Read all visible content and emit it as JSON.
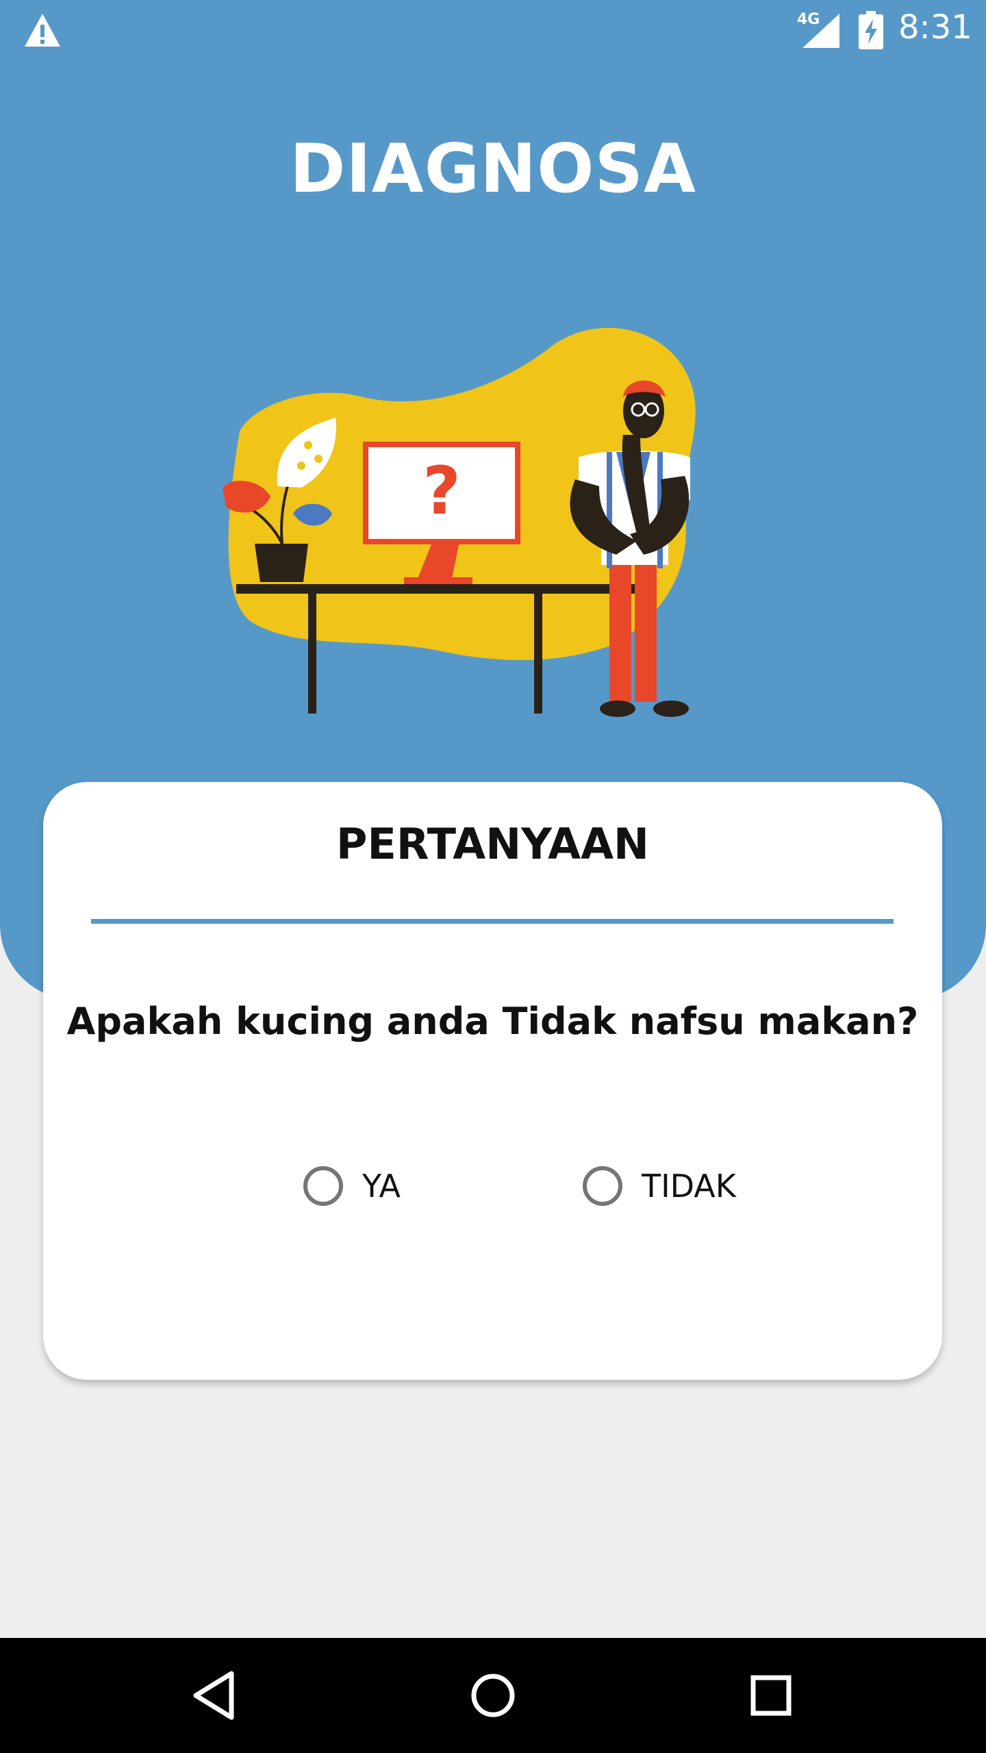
{
  "status_bar": {
    "network": "4G",
    "time": "8:31",
    "icons": [
      "warning-icon",
      "signal-icon",
      "battery-charging-icon"
    ]
  },
  "header": {
    "title": "DIAGNOSA"
  },
  "illustration": {
    "icon": "thinking-person-at-desk-illustration",
    "monitor_symbol": "?"
  },
  "card": {
    "title": "PERTANYAAN",
    "question": "Apakah kucing anda Tidak nafsu makan?",
    "options": [
      {
        "label": "YA",
        "selected": false
      },
      {
        "label": "TIDAK",
        "selected": false
      }
    ]
  },
  "nav": {
    "icons": [
      "back-icon",
      "home-icon",
      "recent-apps-icon"
    ]
  },
  "colors": {
    "header_blue": "#5699c9",
    "background": "#eeeeee",
    "card": "#ffffff",
    "blob_yellow": "#f0c419",
    "accent_red": "#e8472a"
  }
}
